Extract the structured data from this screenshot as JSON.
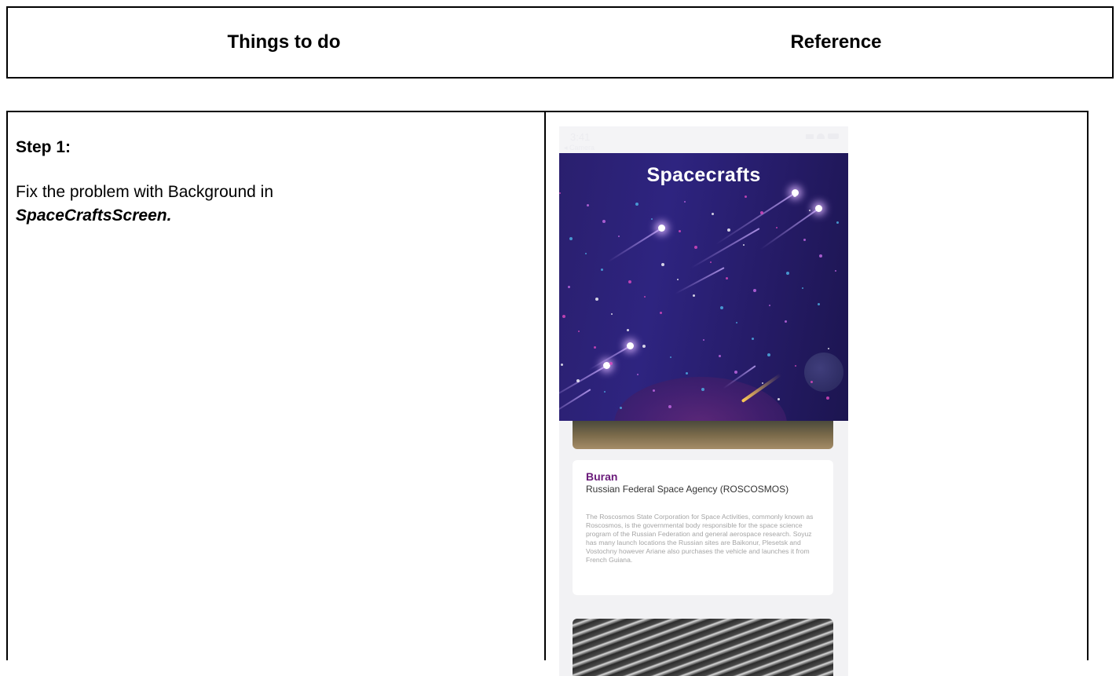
{
  "header": {
    "col1": "Things to do",
    "col2": "Reference"
  },
  "step": {
    "title": "Step 1:",
    "text_prefix": "Fix the problem with Background in",
    "text_emphasis": "SpaceCraftsScreen."
  },
  "phone": {
    "status_time": "3:41",
    "status_back": "◂ Camera",
    "hero_title": "Spacecrafts",
    "colors": {
      "hero_bg": "#2a1f6e",
      "card_name": "#6a1a7a"
    },
    "card": {
      "name": "Buran",
      "agency": "Russian Federal Space Agency (ROSCOSMOS)",
      "description": "The Roscosmos State Corporation for Space Activities, commonly known as Roscosmos, is the governmental body responsible for the space science program of the Russian Federation and general aerospace research. Soyuz has many launch locations the Russian sites are Baikonur, Plesetsk and Vostochny however Ariane also purchases the vehicle and launches it from French Guiana."
    }
  }
}
